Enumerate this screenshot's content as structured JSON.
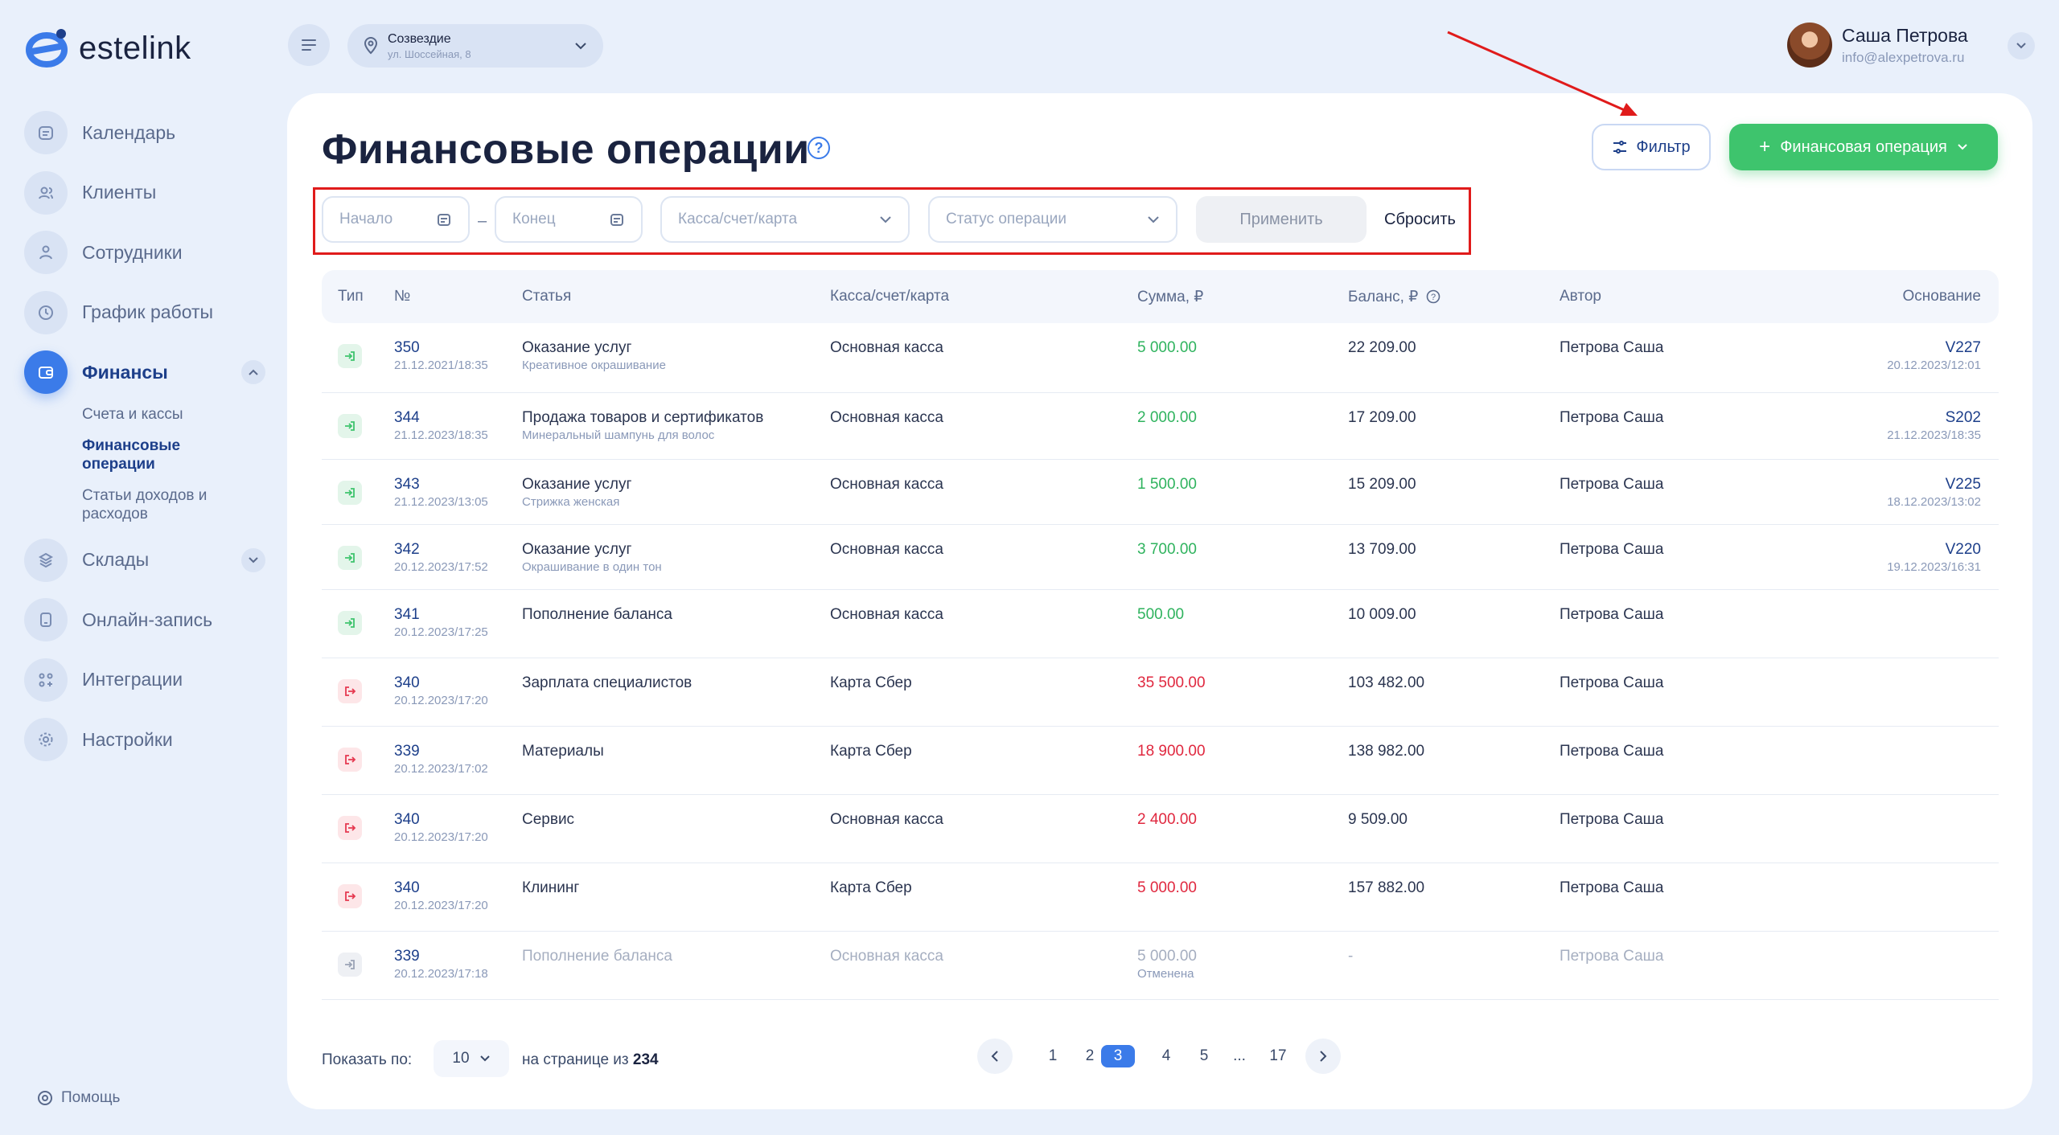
{
  "brand": {
    "name": "estelink"
  },
  "sidebar": {
    "items": [
      {
        "label": "Календарь",
        "icon": "calendar-icon"
      },
      {
        "label": "Клиенты",
        "icon": "clients-icon"
      },
      {
        "label": "Сотрудники",
        "icon": "staff-icon"
      },
      {
        "label": "График работы",
        "icon": "clock-icon"
      },
      {
        "label": "Финансы",
        "icon": "wallet-icon"
      },
      {
        "label": "Склады",
        "icon": "warehouse-icon"
      },
      {
        "label": "Онлайн-запись",
        "icon": "online-booking-icon"
      },
      {
        "label": "Интеграции",
        "icon": "integrations-icon"
      },
      {
        "label": "Настройки",
        "icon": "gear-icon"
      }
    ],
    "finance_sub": [
      {
        "label": "Счета и кассы"
      },
      {
        "label": "Финансовые операции"
      },
      {
        "label": "Статьи доходов и расходов"
      }
    ],
    "help": "Помощь"
  },
  "topbar": {
    "branch_name": "Созвездие",
    "branch_address": "ул. Шоссейная, 8",
    "user_name": "Саша Петрова",
    "user_email": "info@alexpetrova.ru"
  },
  "page": {
    "title": "Финансовые операции",
    "filter_button": "Фильтр",
    "add_button": "Финансовая операция"
  },
  "filters": {
    "start_placeholder": "Начало",
    "end_placeholder": "Конец",
    "account_placeholder": "Касса/счет/карта",
    "status_placeholder": "Статус операции",
    "apply": "Применить",
    "reset": "Сбросить"
  },
  "table": {
    "headers": {
      "type": "Тип",
      "num": "№",
      "article": "Статья",
      "account": "Касса/счет/карта",
      "amount": "Сумма, ₽",
      "balance": "Баланс, ₽",
      "author": "Автор",
      "basis": "Основание"
    },
    "rows": [
      {
        "type": "in",
        "num": "350",
        "date": "21.12.2021/18:35",
        "article": "Оказание услуг",
        "article_sub": "Креативное окрашивание",
        "account": "Основная касса",
        "amount": "5 000.00",
        "amount_note": "",
        "balance": "22 209.00",
        "author": "Петрова Саша",
        "basis": "V227",
        "basis_date": "20.12.2023/12:01"
      },
      {
        "type": "in",
        "num": "344",
        "date": "21.12.2023/18:35",
        "article": "Продажа товаров и сертификатов",
        "article_sub": "Минеральный шампунь для волос",
        "account": "Основная касса",
        "amount": "2 000.00",
        "amount_note": "",
        "balance": "17 209.00",
        "author": "Петрова Саша",
        "basis": "S202",
        "basis_date": "21.12.2023/18:35"
      },
      {
        "type": "in",
        "num": "343",
        "date": "21.12.2023/13:05",
        "article": "Оказание услуг",
        "article_sub": "Стрижка женская",
        "account": "Основная касса",
        "amount": "1 500.00",
        "amount_note": "",
        "balance": "15 209.00",
        "author": "Петрова Саша",
        "basis": "V225",
        "basis_date": "18.12.2023/13:02"
      },
      {
        "type": "in",
        "num": "342",
        "date": "20.12.2023/17:52",
        "article": "Оказание услуг",
        "article_sub": "Окрашивание в один тон",
        "account": "Основная касса",
        "amount": "3 700.00",
        "amount_note": "",
        "balance": "13 709.00",
        "author": "Петрова Саша",
        "basis": "V220",
        "basis_date": "19.12.2023/16:31"
      },
      {
        "type": "in",
        "num": "341",
        "date": "20.12.2023/17:25",
        "article": "Пополнение баланса",
        "article_sub": "",
        "account": "Основная касса",
        "amount": "500.00",
        "amount_note": "",
        "balance": "10 009.00",
        "author": "Петрова Саша",
        "basis": "",
        "basis_date": ""
      },
      {
        "type": "out",
        "num": "340",
        "date": "20.12.2023/17:20",
        "article": "Зарплата специалистов",
        "article_sub": "",
        "account": "Карта Сбер",
        "amount": "35 500.00",
        "amount_note": "",
        "balance": "103 482.00",
        "author": "Петрова Саша",
        "basis": "",
        "basis_date": ""
      },
      {
        "type": "out",
        "num": "339",
        "date": "20.12.2023/17:02",
        "article": "Материалы",
        "article_sub": "",
        "account": "Карта Сбер",
        "amount": "18 900.00",
        "amount_note": "",
        "balance": "138 982.00",
        "author": "Петрова Саша",
        "basis": "",
        "basis_date": ""
      },
      {
        "type": "out",
        "num": "340",
        "date": "20.12.2023/17:20",
        "article": "Сервис",
        "article_sub": "",
        "account": "Основная касса",
        "amount": "2 400.00",
        "amount_note": "",
        "balance": "9 509.00",
        "author": "Петрова Саша",
        "basis": "",
        "basis_date": ""
      },
      {
        "type": "out",
        "num": "340",
        "date": "20.12.2023/17:20",
        "article": "Клининг",
        "article_sub": "",
        "account": "Карта Сбер",
        "amount": "5 000.00",
        "amount_note": "",
        "balance": "157 882.00",
        "author": "Петрова Саша",
        "basis": "",
        "basis_date": ""
      },
      {
        "type": "cancel",
        "num": "339",
        "date": "20.12.2023/17:18",
        "article": "Пополнение баланса",
        "article_sub": "",
        "account": "Основная касса",
        "amount": "5 000.00",
        "amount_note": "Отменена",
        "balance": "-",
        "author": "Петрова Саша",
        "basis": "",
        "basis_date": ""
      }
    ]
  },
  "pagination": {
    "show_label": "Показать по:",
    "per_page": "10",
    "of_label": "на странице из",
    "total": "234",
    "pages": [
      "1",
      "2",
      "3",
      "4",
      "5",
      "...",
      "17"
    ],
    "current": "3"
  },
  "colors": {
    "accent": "#3b7be9",
    "green": "#3ec46d",
    "red": "#e0283f",
    "annotation": "#e01b1b"
  }
}
